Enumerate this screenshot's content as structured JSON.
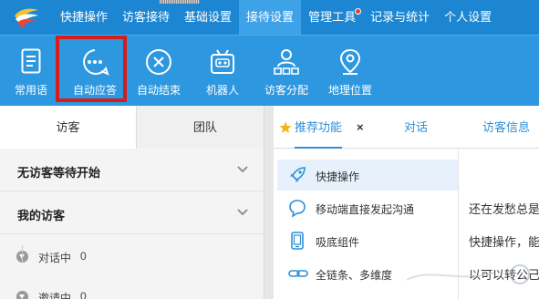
{
  "topnav": {
    "items": [
      {
        "label": "快捷操作"
      },
      {
        "label": "访客接待"
      },
      {
        "label": "基础设置"
      },
      {
        "label": "接待设置"
      },
      {
        "label": "管理工具"
      },
      {
        "label": "记录与统计"
      },
      {
        "label": "个人设置"
      }
    ],
    "active_index": 3
  },
  "toolbar": {
    "items": [
      {
        "label": "常用语",
        "icon": "document-icon"
      },
      {
        "label": "自动应答",
        "icon": "chat-dots-icon"
      },
      {
        "label": "自动结束",
        "icon": "circle-x-icon"
      },
      {
        "label": "机器人",
        "icon": "robot-icon"
      },
      {
        "label": "访客分配",
        "icon": "user-distribute-icon"
      },
      {
        "label": "地理位置",
        "icon": "location-pin-icon"
      }
    ],
    "highlighted_index": 1,
    "highlight_color": "#d71c1c"
  },
  "left": {
    "tabs": [
      {
        "label": "访客"
      },
      {
        "label": "团队"
      }
    ],
    "sections": [
      {
        "title": "无访客等待开始"
      },
      {
        "title": "我的访客"
      }
    ],
    "subs": [
      {
        "label": "对话中",
        "count": "0"
      },
      {
        "label": "邀请中",
        "count": "0"
      }
    ]
  },
  "right": {
    "tabs": [
      {
        "label": "推荐功能"
      },
      {
        "label": "对话"
      },
      {
        "label": "访客信息"
      }
    ],
    "close": "×",
    "features": [
      {
        "label": "快捷操作",
        "icon": "rocket-icon"
      },
      {
        "label": "移动端直接发起沟通",
        "icon": "speech-bubble-icon"
      },
      {
        "label": "吸底组件",
        "icon": "mobile-icon"
      },
      {
        "label": "全链条、多维度",
        "icon": "link-icon"
      }
    ],
    "content": {
      "line1": "还在发愁总是",
      "line2": "快捷操作，能",
      "line3": "以可以转公己"
    }
  },
  "colors": {
    "nav_bg": "#1d86d2",
    "toolbar_bg": "#2d97e0",
    "accent": "#2f8fd8"
  }
}
